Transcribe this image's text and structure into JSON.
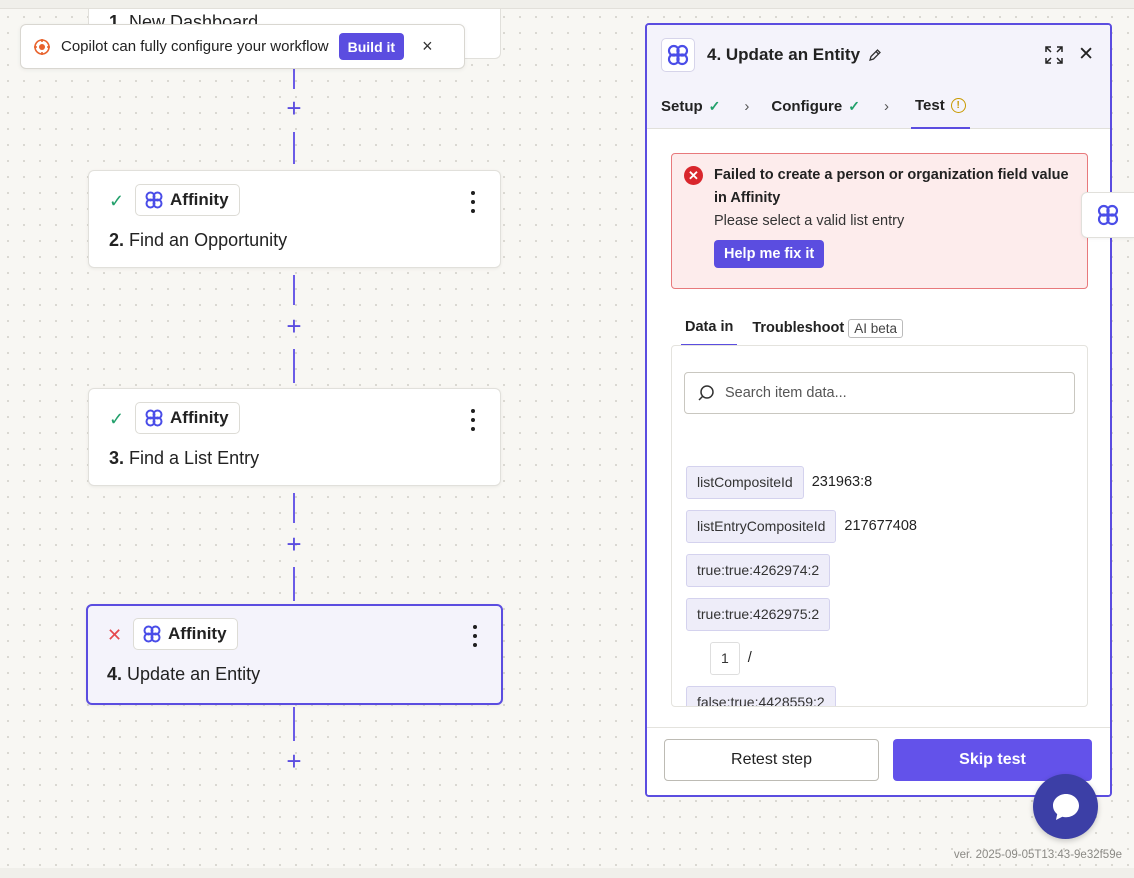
{
  "copilot": {
    "message": "Copilot can fully configure your workflow",
    "build_label": "Build it",
    "close_icon": "×"
  },
  "canvas": {
    "top_step": {
      "number": "1.",
      "title": "New Dashboard"
    },
    "steps": [
      {
        "status": "success",
        "status_glyph": "✓",
        "app": "Affinity",
        "number": "2.",
        "title": "Find an Opportunity"
      },
      {
        "status": "success",
        "status_glyph": "✓",
        "app": "Affinity",
        "number": "3.",
        "title": "Find a List Entry"
      },
      {
        "status": "error",
        "status_glyph": "✕",
        "app": "Affinity",
        "number": "4.",
        "title": "Update an Entity"
      }
    ],
    "add_step_glyph": "+"
  },
  "panel": {
    "title": "4. Update an Entity",
    "close_glyph": "✕",
    "tabs": [
      {
        "label": "Setup",
        "state": "complete",
        "glyph": "✓"
      },
      {
        "label": "Configure",
        "state": "complete",
        "glyph": "✓"
      },
      {
        "label": "Test",
        "state": "warning",
        "glyph": "!"
      }
    ],
    "tab_separator": "›",
    "error": {
      "icon_glyph": "✕",
      "title": "Failed to create a person or organization field value in Affinity",
      "message": "Please select a valid list entry",
      "help_label": "Help me fix it"
    },
    "subtabs": {
      "data_in": "Data in",
      "troubleshoot": "Troubleshoot",
      "ai_badge": "AI beta"
    },
    "search": {
      "placeholder": "Search item data...",
      "value": ""
    },
    "data_rows": [
      {
        "key": "listCompositeId",
        "value": "231963:8"
      },
      {
        "key": "listEntryCompositeId",
        "value": "217677408"
      },
      {
        "key": "true:true:4262974:2",
        "value": ""
      },
      {
        "key": "true:true:4262975:2",
        "value": ""
      },
      {
        "key": "1",
        "value": "/"
      },
      {
        "key": "false:true:4428559:2",
        "value": ""
      }
    ],
    "footer": {
      "retest_label": "Retest step",
      "skip_label": "Skip test"
    }
  },
  "version": "ver. 2025-09-05T13:43-9e32f59e",
  "colors": {
    "accent": "#5b4de0",
    "success": "#22a06b",
    "error": "#d9262c",
    "warning": "#c89a00",
    "chat": "#3c3fa6"
  }
}
